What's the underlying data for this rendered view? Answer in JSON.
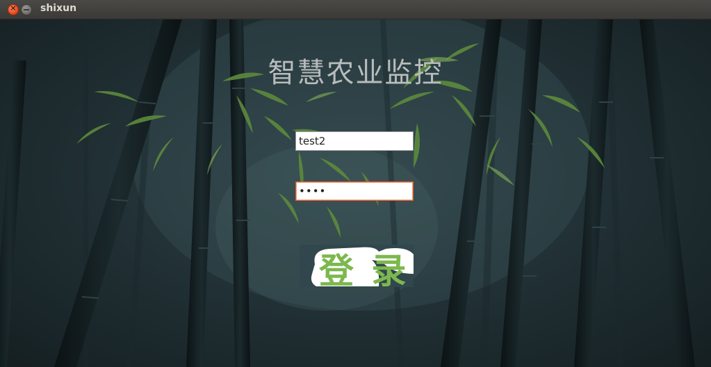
{
  "window": {
    "title": "shixun"
  },
  "app": {
    "title": "智慧农业监控"
  },
  "form": {
    "username_value": "test2",
    "password_value": "test"
  },
  "login_button": {
    "label": "登 录"
  },
  "colors": {
    "title_text": "#b9bcbc",
    "login_text": "#7cb84e",
    "password_focus_border": "#e05a2a"
  }
}
